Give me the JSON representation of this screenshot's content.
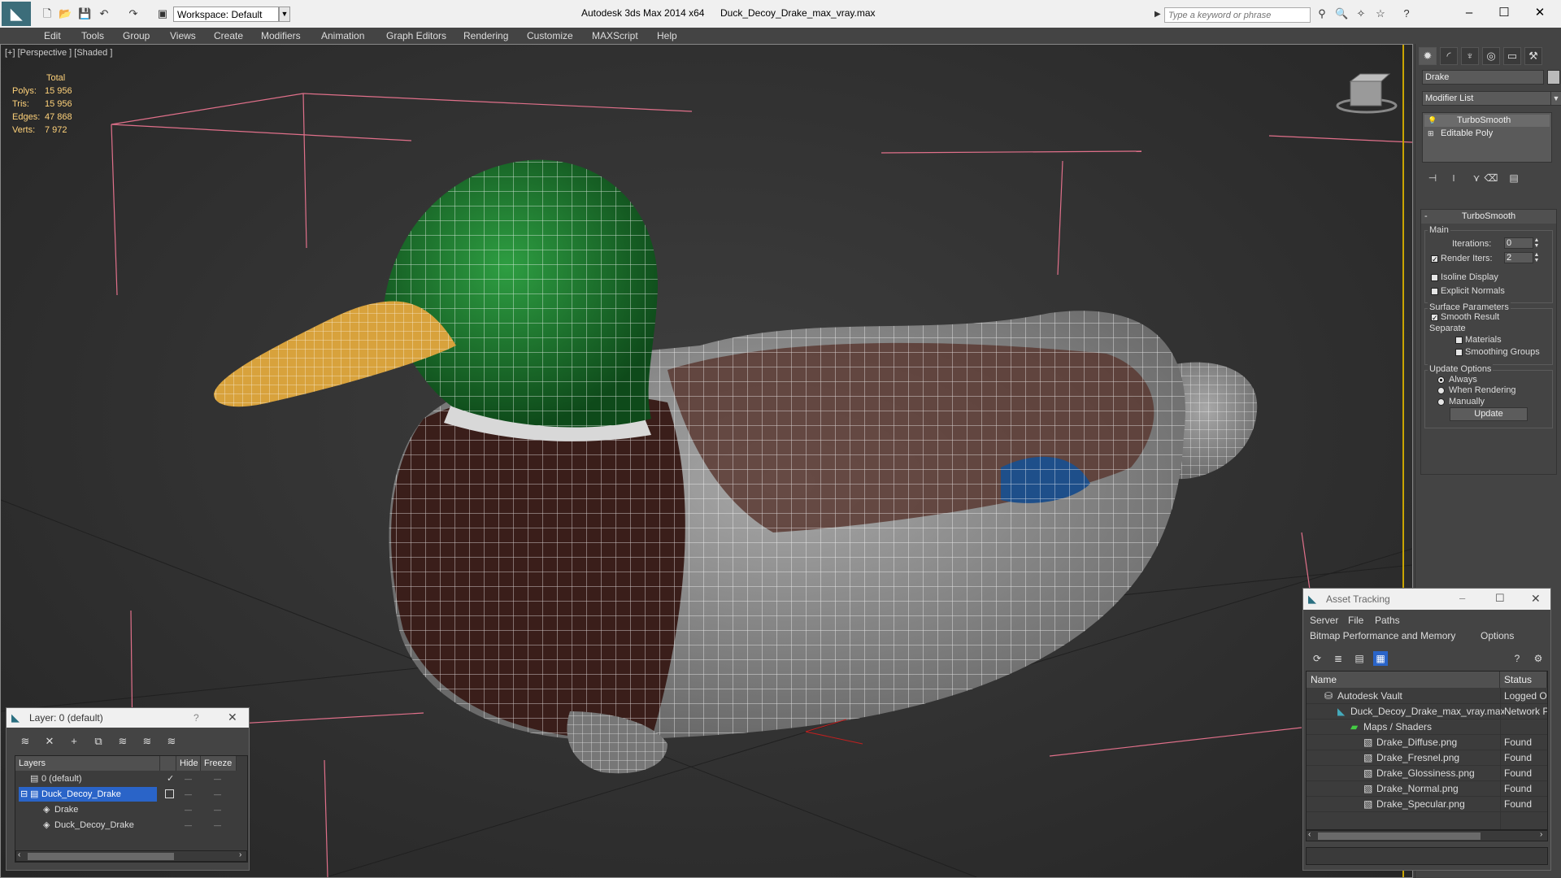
{
  "titlebar": {
    "app_title": "Autodesk 3ds Max  2014 x64",
    "file_title": "Duck_Decoy_Drake_max_vray.max",
    "workspace_label": "Workspace: Default",
    "search_placeholder": "Type a keyword or phrase"
  },
  "menubar": [
    "Edit",
    "Tools",
    "Group",
    "Views",
    "Create",
    "Modifiers",
    "Animation",
    "Graph Editors",
    "Rendering",
    "Customize",
    "MAXScript",
    "Help"
  ],
  "viewport": {
    "label": "[+] [Perspective ] [Shaded ]",
    "stats_header": "Total",
    "stats": [
      {
        "label": "Polys:",
        "value": "15 956"
      },
      {
        "label": "Tris:",
        "value": "15 956"
      },
      {
        "label": "Edges:",
        "value": "47 868"
      },
      {
        "label": "Verts:",
        "value": "7 972"
      }
    ]
  },
  "command_panel": {
    "object_name": "Drake",
    "modifier_list": "Modifier List",
    "stack": [
      "TurboSmooth",
      "Editable Poly"
    ],
    "rollout": {
      "title": "TurboSmooth",
      "main_group": "Main",
      "iterations_label": "Iterations:",
      "iterations_value": "0",
      "render_iters_label": "Render Iters:",
      "render_iters_value": "2",
      "isoline_label": "Isoline Display",
      "explicit_normals_label": "Explicit Normals",
      "surface_group": "Surface Parameters",
      "smooth_result_label": "Smooth Result",
      "separate_label": "Separate",
      "materials_label": "Materials",
      "smoothing_groups_label": "Smoothing Groups",
      "update_group": "Update Options",
      "always_label": "Always",
      "when_rendering_label": "When Rendering",
      "manually_label": "Manually",
      "update_button": "Update"
    }
  },
  "layer_dialog": {
    "title": "Layer: 0 (default)",
    "help": "?",
    "col_layers": "Layers",
    "col_hide": "Hide",
    "col_freeze": "Freeze",
    "rows": [
      "0 (default)",
      "Duck_Decoy_Drake",
      "Drake",
      "Duck_Decoy_Drake"
    ]
  },
  "asset_dialog": {
    "title": "Asset Tracking",
    "menu": [
      "Server",
      "File",
      "Paths"
    ],
    "menu2": [
      "Bitmap Performance and Memory",
      "Options"
    ],
    "col_name": "Name",
    "col_status": "Status",
    "rows": [
      {
        "name": "Autodesk Vault",
        "status": "Logged O"
      },
      {
        "name": "Duck_Decoy_Drake_max_vray.max",
        "status": "Network P"
      },
      {
        "name": "Maps / Shaders",
        "status": ""
      },
      {
        "name": "Drake_Diffuse.png",
        "status": "Found"
      },
      {
        "name": "Drake_Fresnel.png",
        "status": "Found"
      },
      {
        "name": "Drake_Glossiness.png",
        "status": "Found"
      },
      {
        "name": "Drake_Normal.png",
        "status": "Found"
      },
      {
        "name": "Drake_Specular.png",
        "status": "Found"
      }
    ]
  },
  "colors": {
    "selection_blue": "#2a64c8",
    "stats_yellow": "#ffd27a",
    "bbox_pink": "#e0708a",
    "duck_head_green": "#1f7a2e",
    "duck_bill_orange": "#d8a23c"
  }
}
